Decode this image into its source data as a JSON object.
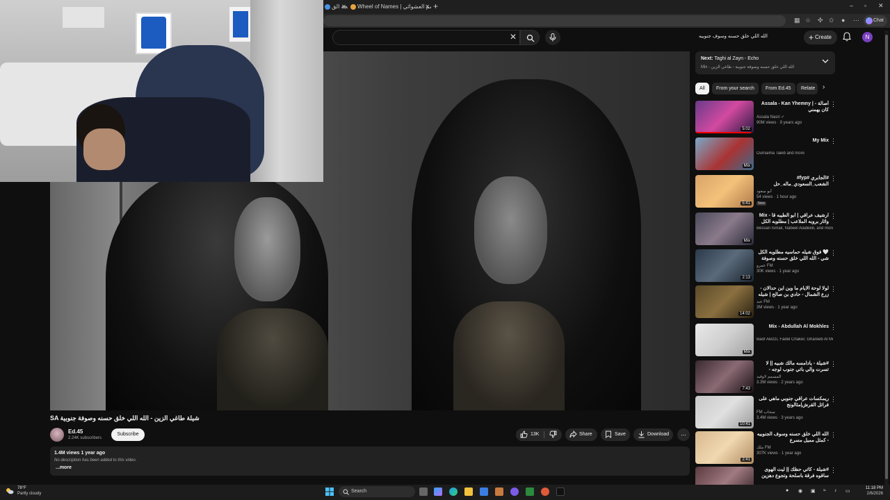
{
  "browser": {
    "tabs": [
      {
        "label": "نيجة الق"
      },
      {
        "label": "Wheel of Names | الاسم العشوائي"
      }
    ],
    "new_tab": "+",
    "chat_label": "Chat"
  },
  "youtube": {
    "search_query": "الله اللي خلق حسنه وسوف جنوبيه",
    "create_label": "Create",
    "avatar_letter": "N"
  },
  "video": {
    "title": "SA شيلة طاغي الزين - الله اللي خلق حسنه وصوفة جنوبية",
    "channel": "Ed.45",
    "subscribers": "2.24K subscribers",
    "subscribe_label": "Subscribe",
    "likes": "13K",
    "share_label": "Share",
    "save_label": "Save",
    "download_label": "Download",
    "more_label": "...",
    "views_date": "1.4M views  1 year ago",
    "description": "No description has been added to this video.",
    "show_more": "...more"
  },
  "up_next": {
    "prefix": "Next:",
    "title": "Taghi al Zayn - Echo",
    "subtitle": "Mix - الله اللي خلق حسنه وصوفة جنوبية - طاغي الزين"
  },
  "chips": [
    {
      "label": "All",
      "active": true
    },
    {
      "label": "From your search",
      "active": false
    },
    {
      "label": "From Ed.45",
      "active": false
    },
    {
      "label": "Relate",
      "active": false
    }
  ],
  "recommendations": [
    {
      "title": "Assala - Kan Yhemny | أصالة - كان يهمني",
      "channel": "Assala Nasri ✓",
      "meta": "90M views · 9 years ago",
      "duration": "5:02",
      "badge": "",
      "progress": 0.95
    },
    {
      "title": "My Mix",
      "channel": "Oumaima Taleb and more",
      "meta": "",
      "duration": "Mix",
      "badge": "",
      "progress": 0
    },
    {
      "title": "#الجابري #fyp# الشعب_السعودي_ماله_حل",
      "channel": "أبو سعود",
      "meta": "54 views · 1 hour ago",
      "duration": "5:41",
      "badge": "New",
      "progress": 0
    },
    {
      "title": "Mix - ارشيف عراقي | ابو الطيبه قا واثار بروبه الملاعب | مطلوبه الكل في",
      "channel": "Bessan Ismail, Nabeel Aladeeb, and more",
      "meta": "",
      "duration": "Mix",
      "badge": "",
      "progress": 0
    },
    {
      "title": "🤍 فوق شيله حماسيه مطلوبه الكل شي - الله اللي خلق حسنه وصوفة جنوبية - مسرع",
      "channel": "عمرو FM",
      "meta": "30K views · 1 year ago",
      "duration": "2:13",
      "badge": "",
      "progress": 0
    },
    {
      "title": "لولا لوحة الايام ما وين اين حدالان - زرع الشمال - حادي بن صالح | شيله ال بريك",
      "channel": "عبد FM",
      "meta": "3M views · 1 year ago",
      "duration": "14:02",
      "badge": "",
      "progress": 0
    },
    {
      "title": "Mix - Abdullah Al Mokhles",
      "channel": "Badr Alezzi, Fadel Chaker, Ghareeb Al Mo...",
      "meta": "",
      "duration": "Mix",
      "badge": "",
      "progress": 0
    },
    {
      "title": "#شيلة - يادامسه مالك شبيه || لا تسرت والي باتي جنوب لوجه - ماعماك الى وقال العالم منه ||",
      "channel": "المسمم لاوقيد",
      "meta": "3.3M views · 2 years ago",
      "duration": "7:43",
      "badge": "",
      "progress": 0
    },
    {
      "title": "ريمكسات عراقي جنوبي ماهي على فراتل القرش|مثالونج",
      "channel": "FM سحاب",
      "meta": "3.4M views · 3 years ago",
      "duration": "10:41",
      "badge": "",
      "progress": 0
    },
    {
      "title": "الله اللي خلق حسنه وسوف الجنوبيه - كمثل مميل مسرع",
      "channel": "ملك FM",
      "meta": "307K views · 1 year ago",
      "duration": "2:41",
      "badge": "",
      "progress": 0
    },
    {
      "title": "#شيلة - كاتي حظك || ليت الهوى ساقوه فرقة باسلحة وتجوع دهزين ... الي تحلي الجين",
      "channel": "",
      "meta": "",
      "duration": "",
      "badge": "",
      "progress": 0
    }
  ],
  "taskbar": {
    "weather_temp": "78°F",
    "weather_desc": "Partly cloudy",
    "search_label": "Search",
    "time": "11:18 PM",
    "date": "2/6/2026"
  },
  "colors": {
    "background": "#0f0f0f",
    "accent_red": "#ff0000",
    "avatar_purple": "#7b3fbf"
  }
}
